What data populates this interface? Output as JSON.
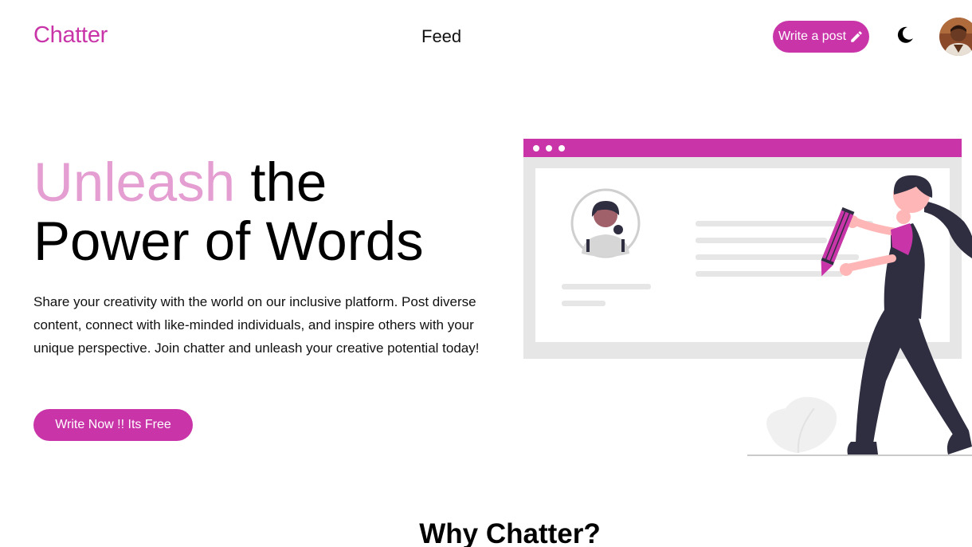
{
  "header": {
    "logo": "Chatter",
    "nav_feed": "Feed",
    "write_post_label": "Write a post",
    "theme_icon": "moon-icon",
    "avatar_icon": "user-avatar"
  },
  "hero": {
    "title_accent": "Unleash",
    "title_rest_1": " the",
    "title_line_2": "Power of Words",
    "description": "Share your creativity with the world on our inclusive platform. Post diverse content, connect with like-minded individuals, and inspire others with your unique perspective. Join chatter and unleash your creative potential today!",
    "cta_label": "Write Now !! Its Free"
  },
  "section": {
    "why_title": "Why Chatter?"
  },
  "colors": {
    "brand": "#c935a9",
    "accent_light": "#e59ed1",
    "figure_dark": "#2f2e41",
    "skin": "#ffb6b6",
    "panel_gray": "#e6e6e6"
  }
}
